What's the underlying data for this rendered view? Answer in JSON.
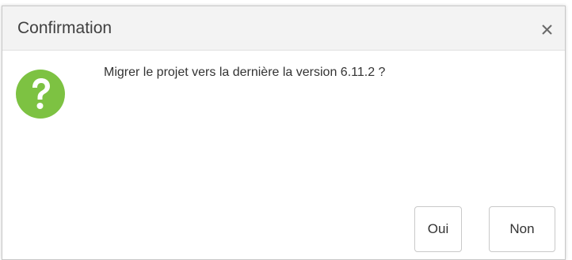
{
  "dialog": {
    "title": "Confirmation",
    "message": "Migrer le projet vers la dernière la version 6.11.2 ?",
    "icon": "question-icon",
    "close_icon": "close-icon",
    "buttons": {
      "yes_label": "Oui",
      "no_label": "Non"
    }
  },
  "colors": {
    "icon_green": "#7dc242",
    "titlebar_bg": "#f3f3f3"
  }
}
